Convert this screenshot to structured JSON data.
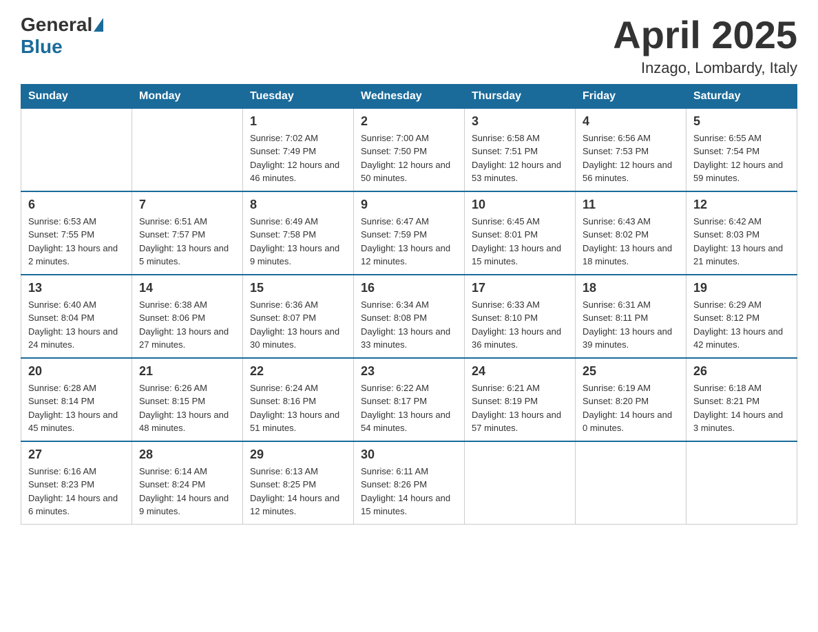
{
  "header": {
    "logo_general": "General",
    "logo_blue": "Blue",
    "month_title": "April 2025",
    "subtitle": "Inzago, Lombardy, Italy"
  },
  "days_of_week": [
    "Sunday",
    "Monday",
    "Tuesday",
    "Wednesday",
    "Thursday",
    "Friday",
    "Saturday"
  ],
  "weeks": [
    [
      {
        "day": "",
        "info": ""
      },
      {
        "day": "",
        "info": ""
      },
      {
        "day": "1",
        "info": "Sunrise: 7:02 AM\nSunset: 7:49 PM\nDaylight: 12 hours\nand 46 minutes."
      },
      {
        "day": "2",
        "info": "Sunrise: 7:00 AM\nSunset: 7:50 PM\nDaylight: 12 hours\nand 50 minutes."
      },
      {
        "day": "3",
        "info": "Sunrise: 6:58 AM\nSunset: 7:51 PM\nDaylight: 12 hours\nand 53 minutes."
      },
      {
        "day": "4",
        "info": "Sunrise: 6:56 AM\nSunset: 7:53 PM\nDaylight: 12 hours\nand 56 minutes."
      },
      {
        "day": "5",
        "info": "Sunrise: 6:55 AM\nSunset: 7:54 PM\nDaylight: 12 hours\nand 59 minutes."
      }
    ],
    [
      {
        "day": "6",
        "info": "Sunrise: 6:53 AM\nSunset: 7:55 PM\nDaylight: 13 hours\nand 2 minutes."
      },
      {
        "day": "7",
        "info": "Sunrise: 6:51 AM\nSunset: 7:57 PM\nDaylight: 13 hours\nand 5 minutes."
      },
      {
        "day": "8",
        "info": "Sunrise: 6:49 AM\nSunset: 7:58 PM\nDaylight: 13 hours\nand 9 minutes."
      },
      {
        "day": "9",
        "info": "Sunrise: 6:47 AM\nSunset: 7:59 PM\nDaylight: 13 hours\nand 12 minutes."
      },
      {
        "day": "10",
        "info": "Sunrise: 6:45 AM\nSunset: 8:01 PM\nDaylight: 13 hours\nand 15 minutes."
      },
      {
        "day": "11",
        "info": "Sunrise: 6:43 AM\nSunset: 8:02 PM\nDaylight: 13 hours\nand 18 minutes."
      },
      {
        "day": "12",
        "info": "Sunrise: 6:42 AM\nSunset: 8:03 PM\nDaylight: 13 hours\nand 21 minutes."
      }
    ],
    [
      {
        "day": "13",
        "info": "Sunrise: 6:40 AM\nSunset: 8:04 PM\nDaylight: 13 hours\nand 24 minutes."
      },
      {
        "day": "14",
        "info": "Sunrise: 6:38 AM\nSunset: 8:06 PM\nDaylight: 13 hours\nand 27 minutes."
      },
      {
        "day": "15",
        "info": "Sunrise: 6:36 AM\nSunset: 8:07 PM\nDaylight: 13 hours\nand 30 minutes."
      },
      {
        "day": "16",
        "info": "Sunrise: 6:34 AM\nSunset: 8:08 PM\nDaylight: 13 hours\nand 33 minutes."
      },
      {
        "day": "17",
        "info": "Sunrise: 6:33 AM\nSunset: 8:10 PM\nDaylight: 13 hours\nand 36 minutes."
      },
      {
        "day": "18",
        "info": "Sunrise: 6:31 AM\nSunset: 8:11 PM\nDaylight: 13 hours\nand 39 minutes."
      },
      {
        "day": "19",
        "info": "Sunrise: 6:29 AM\nSunset: 8:12 PM\nDaylight: 13 hours\nand 42 minutes."
      }
    ],
    [
      {
        "day": "20",
        "info": "Sunrise: 6:28 AM\nSunset: 8:14 PM\nDaylight: 13 hours\nand 45 minutes."
      },
      {
        "day": "21",
        "info": "Sunrise: 6:26 AM\nSunset: 8:15 PM\nDaylight: 13 hours\nand 48 minutes."
      },
      {
        "day": "22",
        "info": "Sunrise: 6:24 AM\nSunset: 8:16 PM\nDaylight: 13 hours\nand 51 minutes."
      },
      {
        "day": "23",
        "info": "Sunrise: 6:22 AM\nSunset: 8:17 PM\nDaylight: 13 hours\nand 54 minutes."
      },
      {
        "day": "24",
        "info": "Sunrise: 6:21 AM\nSunset: 8:19 PM\nDaylight: 13 hours\nand 57 minutes."
      },
      {
        "day": "25",
        "info": "Sunrise: 6:19 AM\nSunset: 8:20 PM\nDaylight: 14 hours\nand 0 minutes."
      },
      {
        "day": "26",
        "info": "Sunrise: 6:18 AM\nSunset: 8:21 PM\nDaylight: 14 hours\nand 3 minutes."
      }
    ],
    [
      {
        "day": "27",
        "info": "Sunrise: 6:16 AM\nSunset: 8:23 PM\nDaylight: 14 hours\nand 6 minutes."
      },
      {
        "day": "28",
        "info": "Sunrise: 6:14 AM\nSunset: 8:24 PM\nDaylight: 14 hours\nand 9 minutes."
      },
      {
        "day": "29",
        "info": "Sunrise: 6:13 AM\nSunset: 8:25 PM\nDaylight: 14 hours\nand 12 minutes."
      },
      {
        "day": "30",
        "info": "Sunrise: 6:11 AM\nSunset: 8:26 PM\nDaylight: 14 hours\nand 15 minutes."
      },
      {
        "day": "",
        "info": ""
      },
      {
        "day": "",
        "info": ""
      },
      {
        "day": "",
        "info": ""
      }
    ]
  ]
}
